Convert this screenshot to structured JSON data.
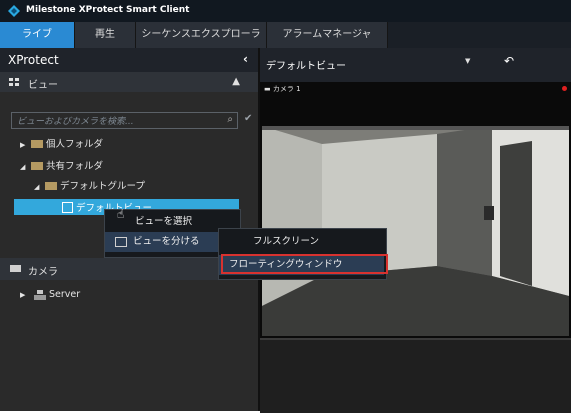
{
  "window": {
    "title": "Milestone XProtect Smart Client"
  },
  "tabs": [
    {
      "label": "ライブ",
      "active": true
    },
    {
      "label": "再生",
      "active": false
    },
    {
      "label": "シーケンスエクスプローラ",
      "active": false
    },
    {
      "label": "アラームマネージャ",
      "active": false
    }
  ],
  "left_panel": {
    "title": "XProtect",
    "collapse_icon": "chevron-left-icon",
    "views_section": {
      "label": "ビュー",
      "toggle_icon": "chevron-up-icon"
    },
    "search_placeholder": "ビューおよびカメラを検索...",
    "tree": {
      "private_folder": "個人フォルダ",
      "shared_folder": "共有フォルダ",
      "default_group": "デフォルトグループ",
      "default_view": "デフォルトビュー"
    },
    "camera_section": {
      "label": "カメラ"
    },
    "camera_tree": {
      "server": "Server"
    }
  },
  "context_menu": {
    "items": [
      "ビューを選択",
      "ビューを分ける"
    ],
    "submenu": [
      "フルスクリーン",
      "フローティングウィンドウ"
    ]
  },
  "right_panel": {
    "view_name": "デフォルトビュー",
    "camera_label": "カメラ 1"
  },
  "colors": {
    "accent": "#2a8ad3",
    "highlight": "#d8322f",
    "selection": "#33a8dc"
  }
}
